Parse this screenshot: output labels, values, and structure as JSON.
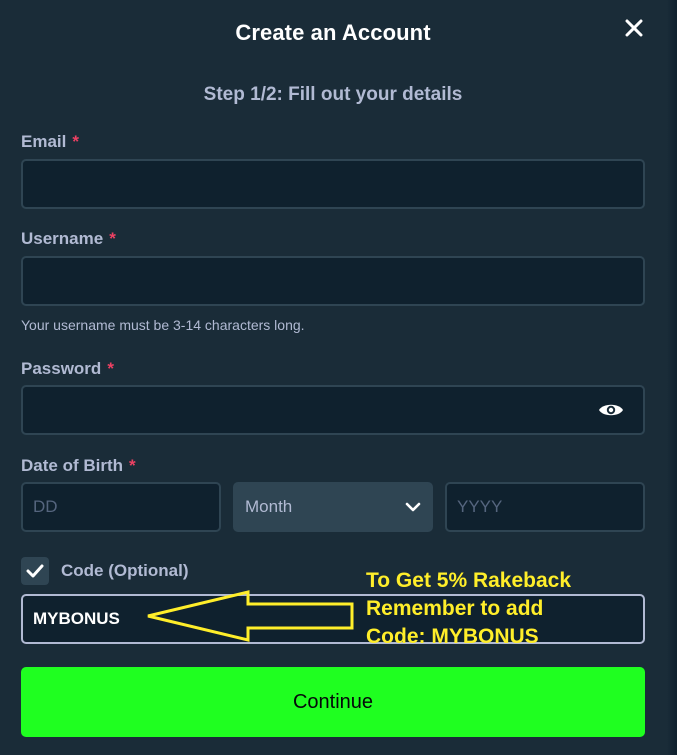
{
  "modal": {
    "title": "Create an Account",
    "step": "Step 1/2: Fill out your details"
  },
  "form": {
    "email": {
      "label": "Email",
      "required_mark": "*",
      "value": "",
      "placeholder": ""
    },
    "username": {
      "label": "Username",
      "required_mark": "*",
      "value": "",
      "placeholder": "",
      "hint": "Your username must be 3-14 characters long."
    },
    "password": {
      "label": "Password",
      "required_mark": "*",
      "value": "",
      "placeholder": "",
      "toggle_icon": "eye-icon"
    },
    "dob": {
      "label": "Date of Birth",
      "required_mark": "*",
      "day_placeholder": "DD",
      "month_selected": "Month",
      "year_placeholder": "YYYY"
    },
    "code": {
      "checked": true,
      "label": "Code (Optional)",
      "value": "MYBONUS"
    },
    "continue_label": "Continue"
  },
  "annotation": {
    "line1": "To Get 5% Rakeback",
    "line2": "Remember to add",
    "line3": "Code: MYBONUS",
    "color": "#ffee2a"
  },
  "colors": {
    "background": "#1a2c38",
    "input_bg": "#0f212e",
    "input_border": "#2f4553",
    "label": "#b1bad3",
    "required": "#ed4163",
    "primary_button": "#1fff20"
  }
}
